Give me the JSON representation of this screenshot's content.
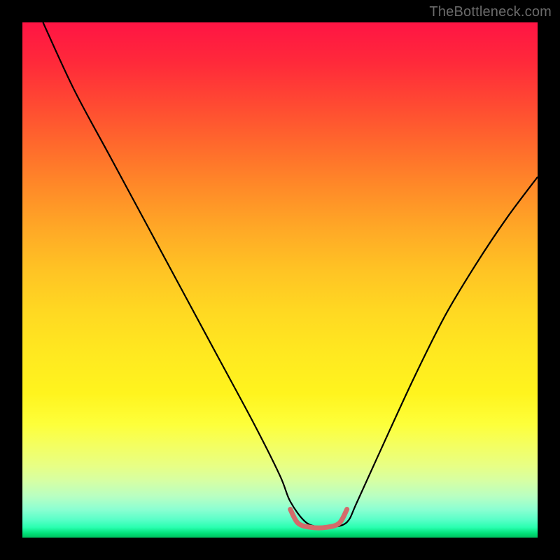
{
  "watermark": {
    "text": "TheBottleneck.com"
  },
  "chart_data": {
    "type": "line",
    "title": "",
    "xlabel": "",
    "ylabel": "",
    "xlim": [
      0,
      100
    ],
    "ylim": [
      0,
      100
    ],
    "grid": false,
    "legend": false,
    "series": [
      {
        "name": "bottleneck-curve",
        "color": "#000000",
        "width": 2.2,
        "x": [
          4,
          10,
          17,
          24,
          31,
          38,
          45,
          50,
          52,
          55,
          58,
          60,
          63,
          65,
          70,
          76,
          82,
          88,
          94,
          100
        ],
        "y": [
          100,
          87,
          74,
          61,
          48,
          35,
          22,
          12,
          7,
          3,
          2,
          2,
          3,
          7,
          18,
          31,
          43,
          53,
          62,
          70
        ]
      },
      {
        "name": "sweet-spot",
        "color": "#d46a6a",
        "width": 7,
        "linecap": "round",
        "x": [
          52,
          53.5,
          56,
          59,
          61.5,
          63
        ],
        "y": [
          5.5,
          2.8,
          2.0,
          2.0,
          2.8,
          5.5
        ]
      }
    ]
  }
}
